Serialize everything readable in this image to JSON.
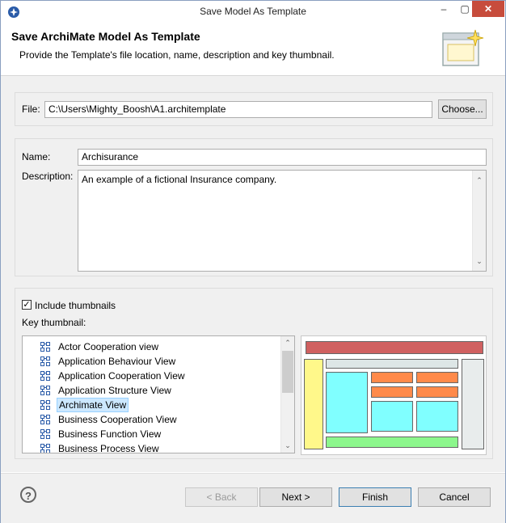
{
  "window": {
    "title": "Save Model As Template",
    "close_symbol": "✕",
    "min_symbol": "‒",
    "max_symbol": "▢"
  },
  "header": {
    "title": "Save ArchiMate Model As Template",
    "description": "Provide the Template's file location, name, description and key thumbnail."
  },
  "file": {
    "label": "File:",
    "value": "C:\\Users\\Mighty_Boosh\\A1.architemplate",
    "choose_label": "Choose..."
  },
  "name": {
    "label": "Name:",
    "value": "Archisurance"
  },
  "description": {
    "label": "Description:",
    "value": "An example of a fictional Insurance company."
  },
  "thumbnails": {
    "include_label": "Include thumbnails",
    "include_checked": true,
    "check_mark": "✓",
    "key_label": "Key thumbnail:",
    "items": [
      {
        "label": "Actor Cooperation view",
        "selected": false
      },
      {
        "label": "Application Behaviour View",
        "selected": false
      },
      {
        "label": "Application Cooperation View",
        "selected": false
      },
      {
        "label": "Application Structure View",
        "selected": false
      },
      {
        "label": "Archimate View",
        "selected": true
      },
      {
        "label": "Business Cooperation View",
        "selected": false
      },
      {
        "label": "Business Function View",
        "selected": false
      },
      {
        "label": "Business Process View",
        "selected": false
      }
    ],
    "preview_colors": {
      "banner": "#d06060",
      "yellow": "#fff88a",
      "cyan": "#80ffff",
      "orange": "#ff8a4a",
      "green": "#8cf78c",
      "grey": "#dde6e6",
      "panel": "#e8ecec"
    }
  },
  "footer": {
    "help_symbol": "?",
    "back_label": "< Back",
    "next_label": "Next >",
    "finish_label": "Finish",
    "cancel_label": "Cancel"
  }
}
